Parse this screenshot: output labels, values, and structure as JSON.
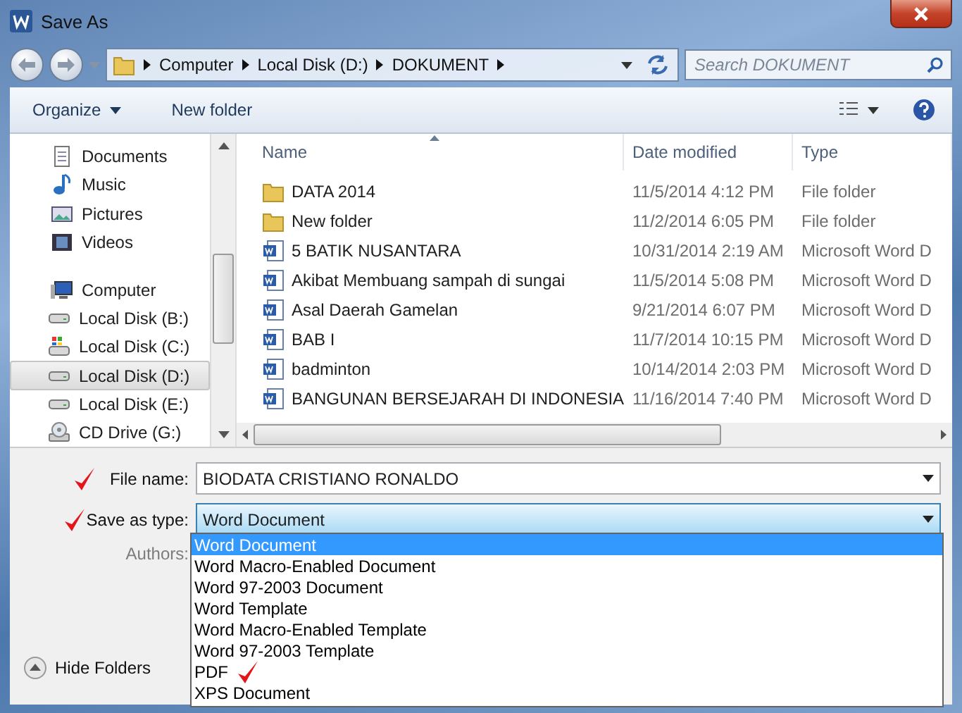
{
  "window": {
    "title": "Save As"
  },
  "address": {
    "crumbs": [
      "Computer",
      "Local Disk (D:)",
      "DOKUMENT"
    ]
  },
  "search": {
    "placeholder": "Search DOKUMENT"
  },
  "toolbar": {
    "buttons": [
      {
        "label": "Organize",
        "menu": true
      },
      {
        "label": "New folder",
        "menu": false
      }
    ]
  },
  "sidebar": {
    "items": [
      {
        "label": "Documents",
        "kind": "documents",
        "selected": false
      },
      {
        "label": "Music",
        "kind": "music",
        "selected": false
      },
      {
        "label": "Pictures",
        "kind": "pictures",
        "selected": false
      },
      {
        "label": "Videos",
        "kind": "videos",
        "selected": false
      },
      {
        "label": "Computer",
        "kind": "computer",
        "selected": false,
        "children": [
          {
            "label": "Local Disk (B:)",
            "kind": "disk",
            "selected": false
          },
          {
            "label": "Local Disk (C:)",
            "kind": "system-disk",
            "selected": false
          },
          {
            "label": "Local Disk (D:)",
            "kind": "disk",
            "selected": true
          },
          {
            "label": "Local Disk (E:)",
            "kind": "disk",
            "selected": false
          },
          {
            "label": "CD Drive (G:)",
            "kind": "cd",
            "selected": false
          }
        ]
      }
    ]
  },
  "table": {
    "columns": [
      {
        "label": "Name",
        "sorted": true
      },
      {
        "label": "Date modified",
        "sorted": false
      },
      {
        "label": "Type",
        "sorted": false
      }
    ],
    "rows": [
      {
        "name": "DATA 2014",
        "date": "11/5/2014 4:12 PM",
        "type": "File folder",
        "kind": "folder"
      },
      {
        "name": "New folder",
        "date": "11/2/2014 6:05 PM",
        "type": "File folder",
        "kind": "folder"
      },
      {
        "name": "5 BATIK NUSANTARA",
        "date": "10/31/2014 2:19 AM",
        "type": "Microsoft Word D",
        "kind": "word"
      },
      {
        "name": "Akibat Membuang sampah di sungai",
        "date": "11/5/2014 5:08 PM",
        "type": "Microsoft Word D",
        "kind": "word"
      },
      {
        "name": "Asal Daerah Gamelan",
        "date": "9/21/2014 6:07 PM",
        "type": "Microsoft Word D",
        "kind": "word"
      },
      {
        "name": "BAB I",
        "date": "11/7/2014 10:15 PM",
        "type": "Microsoft Word D",
        "kind": "word"
      },
      {
        "name": "badminton",
        "date": "10/14/2014 2:03 PM",
        "type": "Microsoft Word D",
        "kind": "word"
      },
      {
        "name": "BANGUNAN BERSEJARAH DI INDONESIA",
        "date": "11/16/2014 7:40 PM",
        "type": "Microsoft Word D",
        "kind": "word"
      }
    ]
  },
  "form": {
    "file_name": {
      "label": "File name:",
      "value": "BIODATA CRISTIANO RONALDO",
      "marked": true
    },
    "save_as_type": {
      "label": "Save as type:",
      "value": "Word Document",
      "marked": true,
      "expanded": true,
      "options": [
        {
          "label": "Word Document",
          "selected": true,
          "marked": false
        },
        {
          "label": "Word Macro-Enabled Document",
          "selected": false,
          "marked": false
        },
        {
          "label": "Word 97-2003 Document",
          "selected": false,
          "marked": false
        },
        {
          "label": "Word Template",
          "selected": false,
          "marked": false
        },
        {
          "label": "Word Macro-Enabled Template",
          "selected": false,
          "marked": false
        },
        {
          "label": "Word 97-2003 Template",
          "selected": false,
          "marked": false
        },
        {
          "label": "PDF",
          "selected": false,
          "marked": true
        },
        {
          "label": "XPS Document",
          "selected": false,
          "marked": false
        }
      ]
    },
    "authors": {
      "label": "Authors:"
    }
  },
  "hide_folders": {
    "label": "Hide Folders"
  }
}
